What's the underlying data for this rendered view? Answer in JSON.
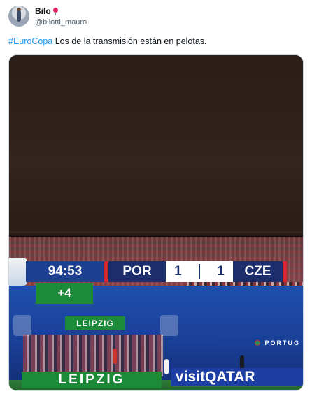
{
  "tweet": {
    "display_name": "Bilo",
    "badge_icon": "pin-icon",
    "handle": "@bilotti_mauro",
    "hashtag": "#EuroCopa",
    "text": " Los de la transmisión están en pelotas."
  },
  "broadcast": {
    "clock": "94:53",
    "home_team": "POR",
    "home_score": "1",
    "away_score": "1",
    "away_team": "CZE",
    "added_time": "+4",
    "sponsor_small": "LEIPZIG",
    "sponsor_big": "LEIPZIG",
    "sponsor_qatar": "visitQATAR",
    "board_portugal": "PORTUG"
  },
  "colors": {
    "hashtag": "#1d9bf0",
    "score_blue": "#1b2e6b",
    "clock_blue": "#1d3f8f",
    "accent_red": "#d7262f",
    "green": "#1d8a3a"
  }
}
